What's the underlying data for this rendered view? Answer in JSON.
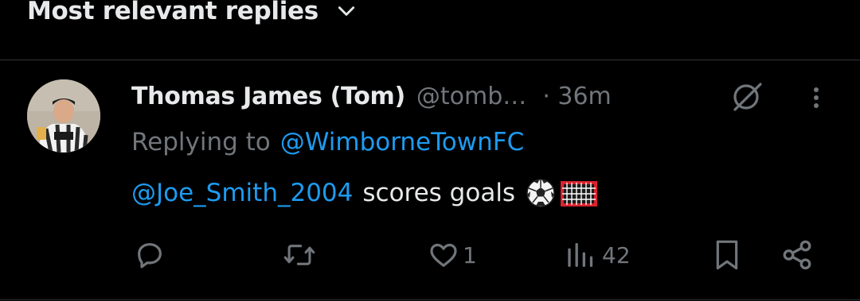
{
  "sort": {
    "label": "Most relevant replies",
    "icon": "chevron-down-icon"
  },
  "reply": {
    "display_name": "Thomas James (Tom)",
    "handle": "@tomb…",
    "time": "· 36m",
    "replying_prefix": "Replying to",
    "replying_to": "@WimborneTownFC",
    "text_mention": "@Joe_Smith_2004",
    "text_body": "scores goals",
    "emojis": [
      "soccer-ball-icon",
      "goal-net-icon"
    ]
  },
  "actions": {
    "reply": {
      "icon": "reply-icon",
      "count": ""
    },
    "repost": {
      "icon": "repost-icon",
      "count": ""
    },
    "like": {
      "icon": "heart-icon",
      "count": "1"
    },
    "views": {
      "icon": "views-chart-icon",
      "count": "42"
    },
    "bookmark": {
      "icon": "bookmark-icon"
    },
    "share": {
      "icon": "share-icon"
    }
  },
  "colors": {
    "background": "#000000",
    "text": "#e7e9ea",
    "muted": "#71767b",
    "link": "#1d9bf0",
    "divider": "#2f3336"
  }
}
